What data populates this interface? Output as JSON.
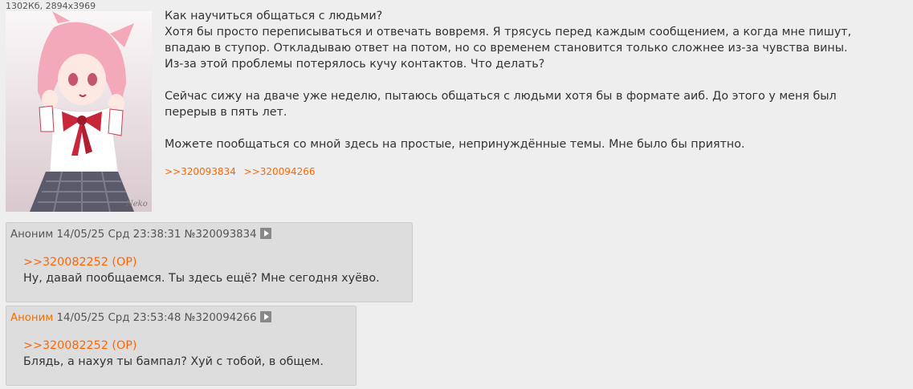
{
  "op": {
    "file_info": "1302Кб, 2894x3969",
    "paragraphs": [
      {
        "lines": [
          "Как научиться общаться с людьми?",
          "Хотя бы просто переписываться и отвечать вовремя. Я трясусь перед каждым сообщением, а когда мне пишут,",
          "впадаю в ступор. Откладываю ответ на потом, но со временем становится только сложнее из-за чувства вины.",
          "Из-за этой проблемы потерялось кучу контактов. Что делать?"
        ]
      },
      {
        "lines": [
          "Сейчас сижу на дваче уже неделю, пытаюсь общаться с людьми хотя бы в формате аиб. До этого у меня был",
          "перерыв в пять лет."
        ]
      },
      {
        "lines": [
          "Можете пообщаться со мной здесь на простые, непринуждённые темы. Мне было бы приятно."
        ]
      }
    ],
    "replies": [
      ">>320093834",
      ">>320094266"
    ]
  },
  "posts": [
    {
      "name": "Аноним",
      "datetime": "14/05/25 Срд 23:38:31",
      "number": "№320093834",
      "quote": ">>320082252 (OP)",
      "text": "Ну, давай пообщаемся. Ты здесь ещё? Мне сегодня хуёво."
    },
    {
      "name": "Аноним",
      "datetime": "14/05/25 Срд 23:53:48",
      "number": "№320094266",
      "quote": ">>320082252 (OP)",
      "text": "Блядь, а нахуя ты бампал? Хуй с тобой, в общем."
    }
  ],
  "colors": {
    "background": "#eeeeee",
    "post_bg": "#dddddd",
    "link": "#ff6600",
    "name_highlight": "#f07000"
  }
}
